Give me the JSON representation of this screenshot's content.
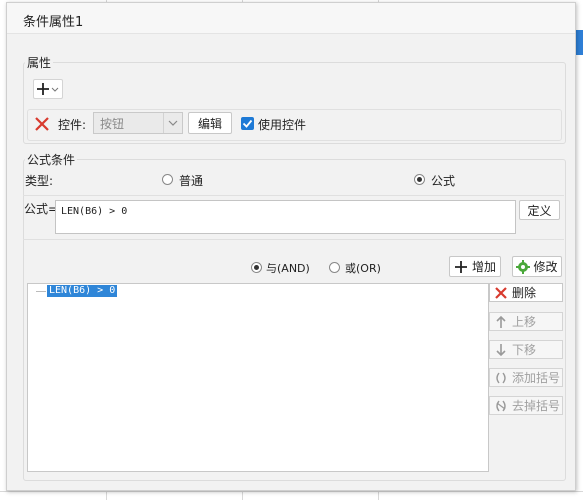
{
  "dialog": {
    "title": "条件属性1"
  },
  "attributes": {
    "label": "属性",
    "add_icon": "plus-icon",
    "control_label": "控件:",
    "control_value": "按钮",
    "edit_label": "编辑",
    "use_control_label": "使用控件",
    "use_control_checked": true
  },
  "formula_condition": {
    "label": "公式条件",
    "type_label": "类型:",
    "option_normal": "普通",
    "option_formula": "公式",
    "selected": "公式",
    "formula_label": "公式=",
    "formula_value": "LEN(B6) > 0",
    "define_label": "定义"
  },
  "logic": {
    "and_label": "与(AND)",
    "or_label": "或(OR)",
    "selected": "与(AND)",
    "add_label": "增加",
    "modify_label": "修改"
  },
  "conditions": {
    "items": [
      "LEN(B6) > 0"
    ]
  },
  "side_buttons": {
    "delete": "删除",
    "move_up": "上移",
    "move_down": "下移",
    "add_bracket": "添加括号",
    "remove_bracket": "去掉括号"
  },
  "colors": {
    "accent": "#1e7ad6",
    "selection": "#2f86d8",
    "delete_red": "#d83a2e"
  }
}
